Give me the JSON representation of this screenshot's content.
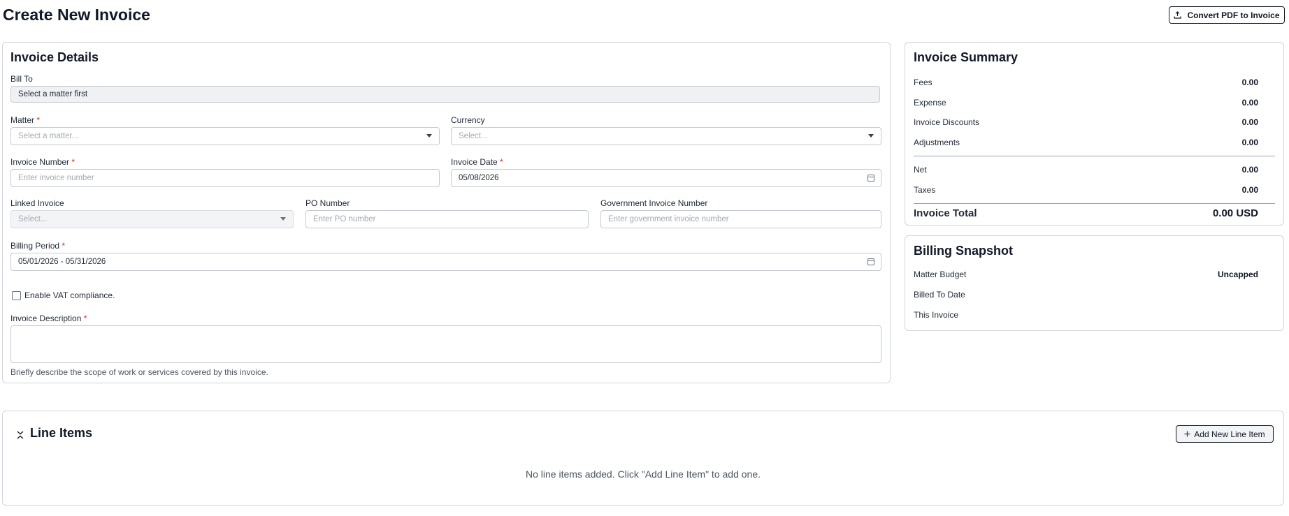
{
  "page": {
    "title": "Create New Invoice",
    "convert_label": "Convert PDF to Invoice"
  },
  "details": {
    "title": "Invoice Details",
    "bill_to_label": "Bill To",
    "bill_to_value": "Select a matter first",
    "matter_label": "Matter",
    "matter_placeholder": "Select a matter...",
    "currency_label": "Currency",
    "currency_placeholder": "Select...",
    "invoice_number_label": "Invoice Number",
    "invoice_number_placeholder": "Enter invoice number",
    "invoice_date_label": "Invoice Date",
    "invoice_date_value": "05/08/2026",
    "linked_invoice_label": "Linked Invoice",
    "linked_invoice_placeholder": "Select...",
    "po_number_label": "PO Number",
    "po_number_placeholder": "Enter PO number",
    "gov_invoice_label": "Government Invoice Number",
    "gov_invoice_placeholder": "Enter government invoice number",
    "billing_period_label": "Billing Period",
    "billing_period_value": "05/01/2026 - 05/31/2026",
    "vat_label": "Enable VAT compliance.",
    "description_label": "Invoice Description",
    "description_help": "Briefly describe the scope of work or services covered by this invoice.",
    "required_mark": "*"
  },
  "summary": {
    "title": "Invoice Summary",
    "rows": [
      {
        "label": "Fees",
        "value": "0.00"
      },
      {
        "label": "Expense",
        "value": "0.00"
      },
      {
        "label": "Invoice Discounts",
        "value": "0.00"
      },
      {
        "label": "Adjustments",
        "value": "0.00"
      },
      {
        "label": "Net",
        "value": "0.00"
      },
      {
        "label": "Taxes",
        "value": "0.00"
      }
    ],
    "total_label": "Invoice Total",
    "total_value": "0.00 USD"
  },
  "snapshot": {
    "title": "Billing Snapshot",
    "rows": [
      {
        "label": "Matter Budget",
        "value": "Uncapped"
      },
      {
        "label": "Billed To Date",
        "value": ""
      },
      {
        "label": "This Invoice",
        "value": ""
      }
    ]
  },
  "line_items": {
    "title": "Line Items",
    "add_label": "Add New Line Item",
    "empty_message": "No line items added. Click \"Add Line Item\" to add one."
  },
  "icons": {
    "upload": "upload-icon",
    "plus": "plus-icon",
    "collapse": "chevrons-collapse-icon",
    "calendar": "calendar-icon",
    "dropdown": "chevron-down-icon"
  }
}
